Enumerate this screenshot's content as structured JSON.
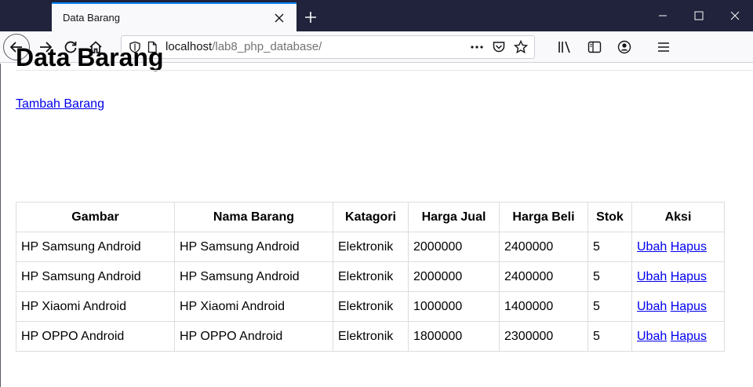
{
  "browser": {
    "tab_title": "Data Barang",
    "url_host": "localhost",
    "url_path": "/lab8_php_database/",
    "icons": {
      "close_tab": "close-icon",
      "new_tab": "plus-icon",
      "back": "arrow-left-icon",
      "forward": "arrow-right-icon",
      "reload": "reload-icon",
      "home": "home-icon",
      "shield": "shield-icon",
      "page": "page-icon",
      "more": "more-icon",
      "pocket": "pocket-icon",
      "bookmark": "star-icon",
      "library": "library-icon",
      "sidebar": "sidebar-icon",
      "account": "account-icon",
      "menu": "menu-icon"
    },
    "accent": "#0a84ff"
  },
  "page": {
    "title": "Data Barang",
    "add_link": "Tambah Barang",
    "table": {
      "headers": [
        "Gambar",
        "Nama Barang",
        "Katagori",
        "Harga Jual",
        "Harga Beli",
        "Stok",
        "Aksi"
      ],
      "rows": [
        {
          "gambar": "HP Samsung Android",
          "nama": "HP Samsung Android",
          "kategori": "Elektronik",
          "harga_jual": "2000000",
          "harga_beli": "2400000",
          "stok": "5",
          "ubah": "Ubah",
          "hapus": "Hapus"
        },
        {
          "gambar": "HP Samsung Android",
          "nama": "HP Samsung Android",
          "kategori": "Elektronik",
          "harga_jual": "2000000",
          "harga_beli": "2400000",
          "stok": "5",
          "ubah": "Ubah",
          "hapus": "Hapus"
        },
        {
          "gambar": "HP Xiaomi Android",
          "nama": "HP Xiaomi Android",
          "kategori": "Elektronik",
          "harga_jual": "1000000",
          "harga_beli": "1400000",
          "stok": "5",
          "ubah": "Ubah",
          "hapus": "Hapus"
        },
        {
          "gambar": "HP OPPO Android",
          "nama": "HP OPPO Android",
          "kategori": "Elektronik",
          "harga_jual": "1800000",
          "harga_beli": "2300000",
          "stok": "5",
          "ubah": "Ubah",
          "hapus": "Hapus"
        }
      ]
    },
    "link_color": "#0000ee"
  }
}
